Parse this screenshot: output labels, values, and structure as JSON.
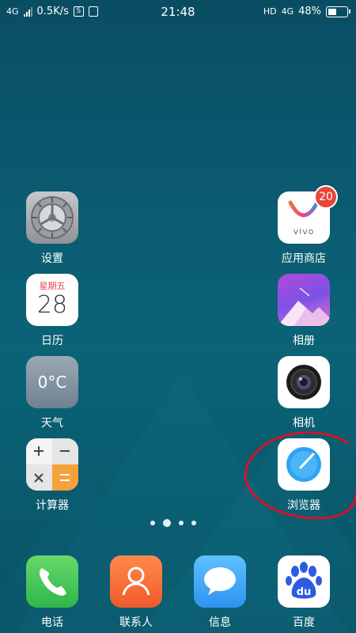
{
  "status_bar": {
    "network_left": "4G",
    "speed": "0.5K/s",
    "sim_badge": "S",
    "time": "21:48",
    "hd": "HD",
    "network_right": "4G",
    "battery_percent": "48%",
    "battery_level": 0.48
  },
  "apps": {
    "settings": {
      "label": "设置",
      "icon": "gear-icon"
    },
    "calendar": {
      "label": "日历",
      "weekday": "星期五",
      "day": "28",
      "icon": "calendar-icon"
    },
    "weather": {
      "label": "天气",
      "temp": "0°C",
      "icon": "weather-icon"
    },
    "calculator": {
      "label": "计算器",
      "icon": "calculator-icon"
    },
    "app_store": {
      "label": "应用商店",
      "brand": "vivo",
      "badge": "20",
      "icon": "vivo-store-icon"
    },
    "gallery": {
      "label": "相册",
      "icon": "mountain-icon"
    },
    "camera": {
      "label": "相机",
      "icon": "camera-lens-icon"
    },
    "browser": {
      "label": "浏览器",
      "icon": "compass-icon"
    }
  },
  "dock": {
    "phone": {
      "label": "电话",
      "icon": "phone-handset-icon"
    },
    "contacts": {
      "label": "联系人",
      "icon": "person-icon"
    },
    "messages": {
      "label": "信息",
      "icon": "speech-bubble-icon"
    },
    "baidu": {
      "label": "百度",
      "brand": "du",
      "icon": "baidu-paw-icon"
    }
  },
  "page_indicator": {
    "pages": 4,
    "current": 2
  },
  "annotation": {
    "color": "#d4132a",
    "target": "browser"
  }
}
